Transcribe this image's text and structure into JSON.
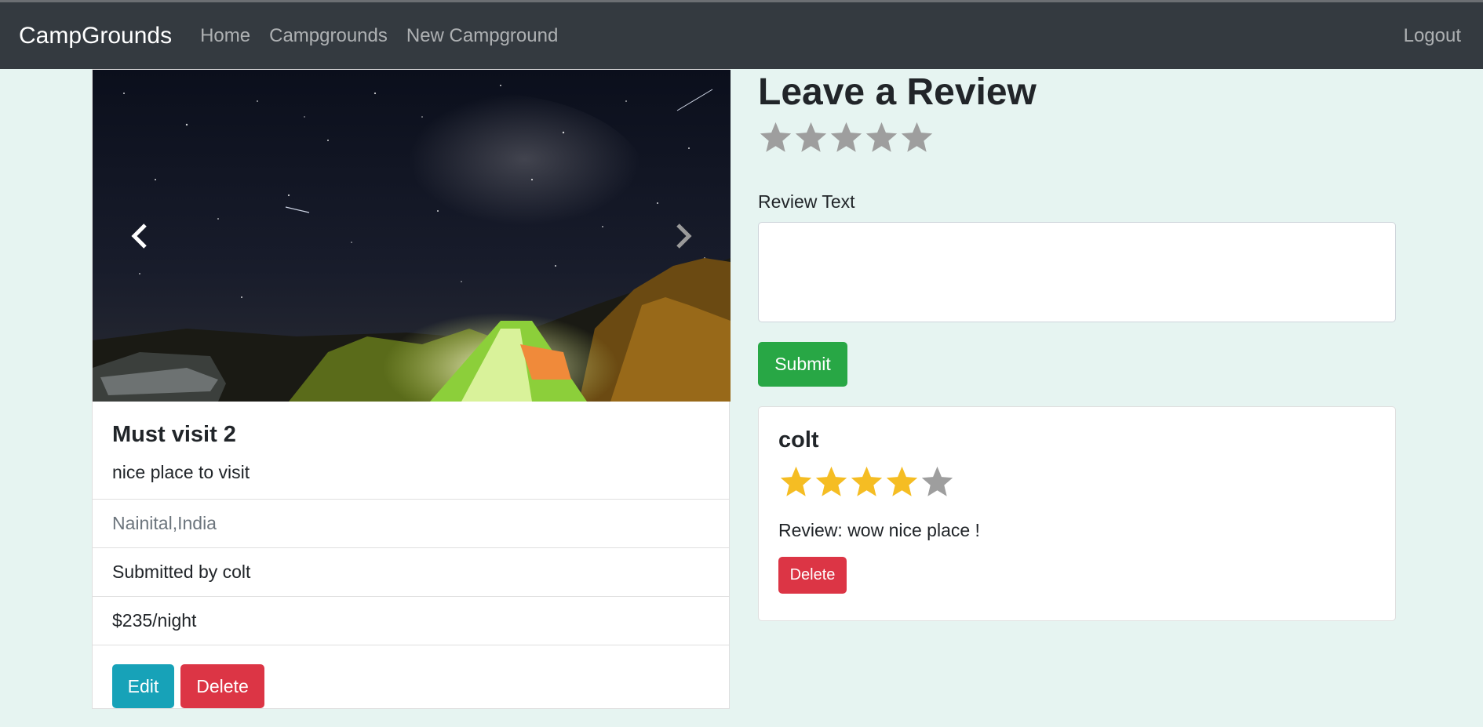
{
  "nav": {
    "brand": "CampGrounds",
    "links": [
      "Home",
      "Campgrounds",
      "New Campground"
    ],
    "logout": "Logout"
  },
  "campground": {
    "title": "Must visit 2",
    "description": "nice place to visit",
    "location": "Nainital,India",
    "submitted_by": "Submitted by colt",
    "price": "$235/night",
    "edit_label": "Edit",
    "delete_label": "Delete"
  },
  "review_form": {
    "heading": "Leave a Review",
    "rating": 0,
    "max_rating": 5,
    "text_label": "Review Text",
    "text_value": "",
    "submit_label": "Submit"
  },
  "reviews": [
    {
      "author": "colt",
      "rating": 4,
      "max_rating": 5,
      "body": "Review: wow nice place !",
      "delete_label": "Delete"
    }
  ],
  "colors": {
    "star_filled": "#f5bd23",
    "star_empty": "#9e9e9e",
    "page_bg": "#e6f4f1",
    "navbar_bg": "#343a40"
  }
}
